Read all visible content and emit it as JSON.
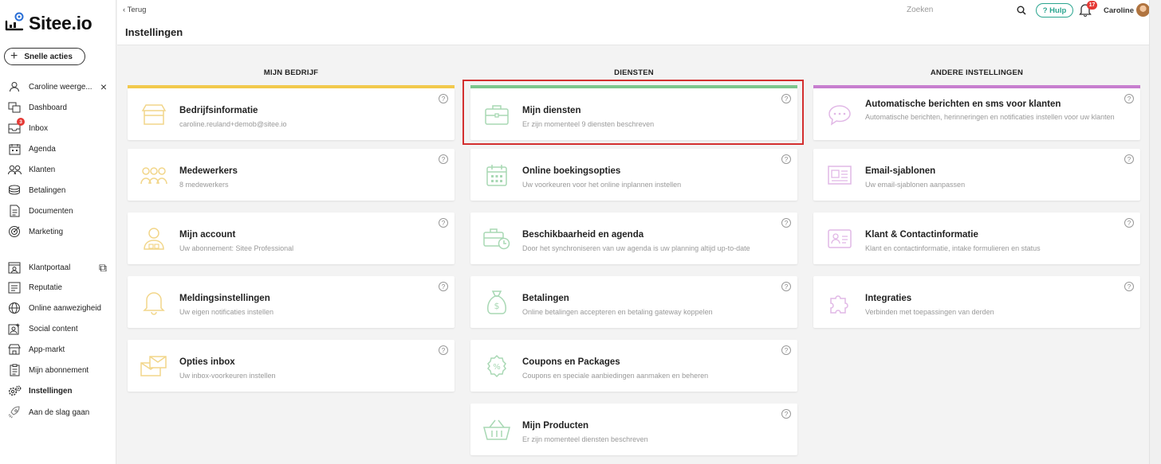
{
  "app": {
    "logo_text": "Sitee.io",
    "quick_actions": "Snelle acties"
  },
  "sidebar": {
    "items": [
      {
        "label": "Caroline weerge...",
        "icon": "user-icon",
        "trail": "×"
      },
      {
        "label": "Dashboard",
        "icon": "dashboard-icon"
      },
      {
        "label": "Inbox",
        "icon": "inbox-icon",
        "badge": "3"
      },
      {
        "label": "Agenda",
        "icon": "calendar-icon"
      },
      {
        "label": "Klanten",
        "icon": "users-icon"
      },
      {
        "label": "Betalingen",
        "icon": "coins-icon"
      },
      {
        "label": "Documenten",
        "icon": "document-icon"
      },
      {
        "label": "Marketing",
        "icon": "target-icon"
      },
      {
        "label": "Klantportaal",
        "icon": "portal-icon",
        "trail": "⧉"
      },
      {
        "label": "Reputatie",
        "icon": "reputation-icon"
      },
      {
        "label": "Online aanwezigheid",
        "icon": "globe-icon"
      },
      {
        "label": "Social content",
        "icon": "social-icon"
      },
      {
        "label": "App-markt",
        "icon": "store-icon"
      },
      {
        "label": "Mijn abonnement",
        "icon": "clipboard-icon"
      },
      {
        "label": "Instellingen",
        "icon": "gear-icon",
        "active": true
      },
      {
        "label": "Aan de slag gaan",
        "icon": "rocket-icon"
      }
    ]
  },
  "header": {
    "back": "Terug",
    "title": "Instellingen",
    "search_placeholder": "Zoeken",
    "help": "Hulp",
    "notifications": "17",
    "user": "Caroline"
  },
  "columns": [
    {
      "title": "MIJN BEDRIJF",
      "color": "#f2c94c",
      "cards": [
        {
          "title": "Bedrijfsinformatie",
          "desc": "caroline.reuland+demob@sitee.io",
          "icon": "store-icon"
        },
        {
          "title": "Medewerkers",
          "desc": "8 medewerkers",
          "icon": "team-icon"
        },
        {
          "title": "Mijn account",
          "desc": "Uw abonnement: Sitee Professional",
          "icon": "account-icon"
        },
        {
          "title": "Meldingsinstellingen",
          "desc": "Uw eigen notificaties instellen",
          "icon": "bell-icon"
        },
        {
          "title": "Opties inbox",
          "desc": "Uw inbox-voorkeuren instellen",
          "icon": "inbox-icon"
        }
      ]
    },
    {
      "title": "DIENSTEN",
      "color": "#7cc68d",
      "cards": [
        {
          "title": "Mijn diensten",
          "desc": "Er zijn momenteel 9 diensten beschreven",
          "icon": "briefcase-icon"
        },
        {
          "title": "Online boekingsopties",
          "desc": "Uw voorkeuren voor het online inplannen instellen",
          "icon": "calendar-icon"
        },
        {
          "title": "Beschikbaarheid en agenda",
          "desc": "Door het synchroniseren van uw agenda is uw planning altijd up-to-date",
          "icon": "briefcase-clock-icon"
        },
        {
          "title": "Betalingen",
          "desc": "Online betalingen accepteren en betaling gateway koppelen",
          "icon": "money-bag-icon"
        },
        {
          "title": "Coupons en Packages",
          "desc": "Coupons en speciale aanbiedingen aanmaken en beheren",
          "icon": "coupon-icon"
        },
        {
          "title": "Mijn Producten",
          "desc": "Er zijn momenteel diensten beschreven",
          "icon": "basket-icon"
        }
      ]
    },
    {
      "title": "ANDERE INSTELLINGEN",
      "color": "#c77ecf",
      "cards": [
        {
          "title": "Automatische berichten en sms voor klanten",
          "desc": "Automatische berichten, herinneringen en notificaties instellen voor uw klanten",
          "icon": "chat-icon",
          "tall": true
        },
        {
          "title": "Email-sjablonen",
          "desc": "Uw email-sjablonen aanpassen",
          "icon": "email-template-icon"
        },
        {
          "title": "Klant & Contactinformatie",
          "desc": "Klant en contactinformatie, intake formulieren en status",
          "icon": "contact-card-icon"
        },
        {
          "title": "Integraties",
          "desc": "Verbinden met toepassingen van derden",
          "icon": "puzzle-icon"
        }
      ]
    }
  ]
}
